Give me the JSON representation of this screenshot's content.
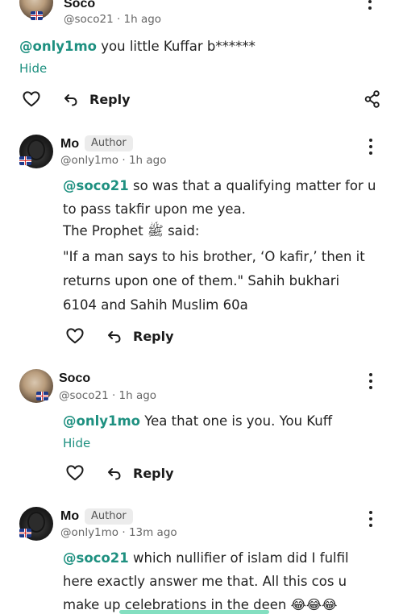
{
  "comments": [
    {
      "author": "Soco",
      "handle": "@soco21",
      "time": "1h ago",
      "mention": "@only1mo",
      "text": " you little Kuffar b******",
      "hide_label": "Hide",
      "reply_label": "Reply"
    },
    {
      "author": "Mo",
      "badge": "Author",
      "handle": "@only1mo",
      "time": "1h ago",
      "mention": "@soco21",
      "text_line1": " so was that a qualifying matter for u",
      "text_line2": "to pass takfir upon me yea.",
      "text_line3": "The Prophet ﷺ said:",
      "quote_line1": "\"If a man says to his brother, ‘O kafir,’ then it",
      "quote_line2": "returns upon one of them.\" Sahih bukhari",
      "quote_line3": "6104 and Sahih Muslim 60a",
      "reply_label": "Reply"
    },
    {
      "author": "Soco",
      "handle": "@soco21",
      "time": "1h ago",
      "mention": "@only1mo",
      "text": " Yea that one is you. You Kuff",
      "hide_label": "Hide",
      "reply_label": "Reply"
    },
    {
      "author": "Mo",
      "badge": "Author",
      "handle": "@only1mo",
      "time": "13m ago",
      "mention": "@soco21",
      "text_line1": " which nullifier of islam did I fulfil",
      "text_line2": "here exactly answer me that. All this cos u",
      "text_line3": "make up celebrations in the deen 😂😂😂"
    }
  ],
  "separator": " · ",
  "icons": {
    "like": "heart-outline-icon",
    "reply": "reply-arrow-icon",
    "share": "share-icon",
    "more": "more-vertical-icon",
    "flag": "uk-flag-icon"
  },
  "colors": {
    "mention": "#1e9080",
    "badge_bg": "#ececec"
  }
}
